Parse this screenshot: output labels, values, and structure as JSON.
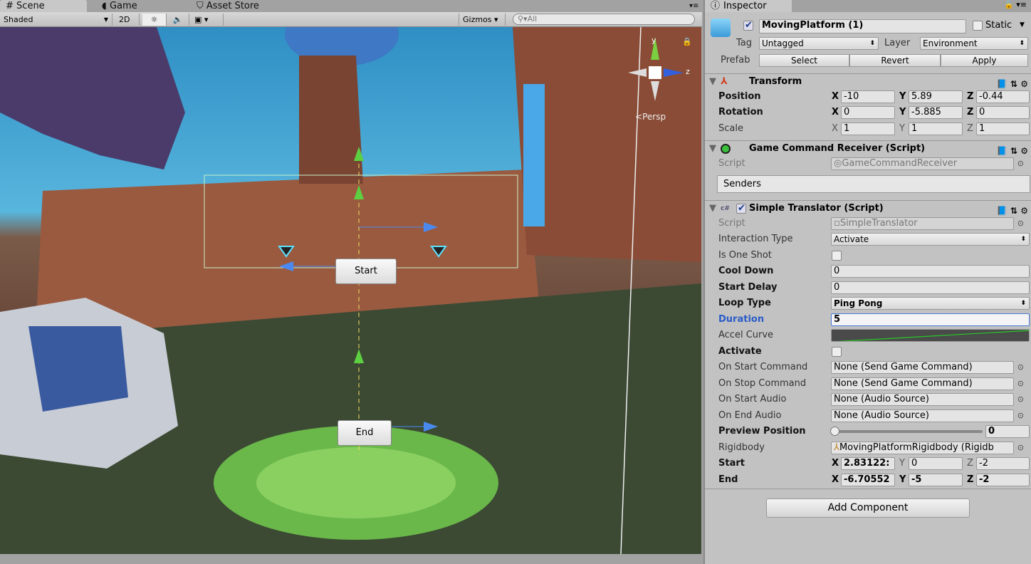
{
  "scene_tabs": [
    {
      "label": "Scene",
      "icon": "hash-icon"
    },
    {
      "label": "Game",
      "icon": "pacman-icon"
    },
    {
      "label": "Asset Store",
      "icon": "bag-icon"
    }
  ],
  "scene_toolbar": {
    "shading": "Shaded",
    "mode_2d": "2D",
    "gizmos": "Gizmos",
    "search_placeholder": "All"
  },
  "viewport": {
    "persp_label": "Persp",
    "gizmo_axes": {
      "y": "y",
      "z": "z"
    },
    "start_label": "Start",
    "end_label": "End"
  },
  "inspector": {
    "tab_label": "Inspector",
    "object_name": "MovingPlatform (1)",
    "static_label": "Static",
    "tag_label": "Tag",
    "tag_value": "Untagged",
    "layer_label": "Layer",
    "layer_value": "Environment",
    "prefab_label": "Prefab",
    "prefab_buttons": [
      "Select",
      "Revert",
      "Apply"
    ],
    "transform": {
      "title": "Transform",
      "position": {
        "label": "Position",
        "x": "-10",
        "y": "5.89",
        "z": "-0.44"
      },
      "rotation": {
        "label": "Rotation",
        "x": "0",
        "y": "-5.885",
        "z": "0"
      },
      "scale": {
        "label": "Scale",
        "x": "1",
        "y": "1",
        "z": "1"
      }
    },
    "gcr": {
      "title": "Game Command Receiver (Script)",
      "script_label": "Script",
      "script_value": "GameCommandReceiver",
      "senders": "Senders"
    },
    "st": {
      "title": "Simple Translator (Script)",
      "script_label": "Script",
      "script_value": "SimpleTranslator",
      "interaction_type_label": "Interaction Type",
      "interaction_type": "Activate",
      "is_one_shot_label": "Is One Shot",
      "cool_down_label": "Cool Down",
      "cool_down": "0",
      "start_delay_label": "Start Delay",
      "start_delay": "0",
      "loop_type_label": "Loop Type",
      "loop_type": "Ping Pong",
      "duration_label": "Duration",
      "duration": "5",
      "accel_curve_label": "Accel Curve",
      "activate_label": "Activate",
      "on_start_command_label": "On Start Command",
      "on_start_command": "None (Send Game Command)",
      "on_stop_command_label": "On Stop Command",
      "on_stop_command": "None (Send Game Command)",
      "on_start_audio_label": "On Start Audio",
      "on_start_audio": "None (Audio Source)",
      "on_end_audio_label": "On End Audio",
      "on_end_audio": "None (Audio Source)",
      "preview_position_label": "Preview Position",
      "preview_position": "0",
      "rigidbody_label": "Rigidbody",
      "rigidbody": "MovingPlatformRigidbody (Rigidb",
      "start": {
        "label": "Start",
        "x": "2.83122:",
        "y": "0",
        "z": "-2"
      },
      "end": {
        "label": "End",
        "x": "-6.70552",
        "y": "-5",
        "z": "-2"
      }
    },
    "add_component": "Add Component"
  },
  "colors": {
    "selected_label": "#2a5cc8",
    "curve": "#28c828"
  }
}
